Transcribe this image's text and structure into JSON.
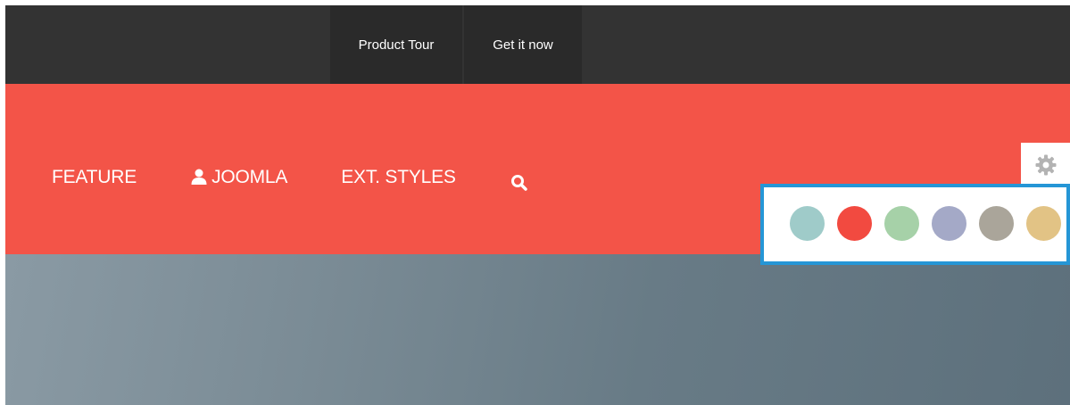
{
  "topbar": {
    "bg_color": "#333333",
    "items": [
      {
        "label": "Product Tour"
      },
      {
        "label": "Get it now"
      }
    ]
  },
  "mainbar": {
    "bg_color": "#f35448",
    "items": [
      {
        "label": "FEATURE"
      },
      {
        "label": "JOOMLA",
        "icon": "user-icon"
      },
      {
        "label": "EXT. STYLES"
      }
    ],
    "search_icon": "search-icon"
  },
  "style_switcher": {
    "toggle_icon": "gear-icon",
    "highlight_color": "#2596d6",
    "swatches": [
      {
        "color": "#9fcbc9"
      },
      {
        "color": "#f24a40"
      },
      {
        "color": "#a6d1a8"
      },
      {
        "color": "#a4a9c7"
      },
      {
        "color": "#aaa59a"
      },
      {
        "color": "#e2c385"
      }
    ]
  }
}
